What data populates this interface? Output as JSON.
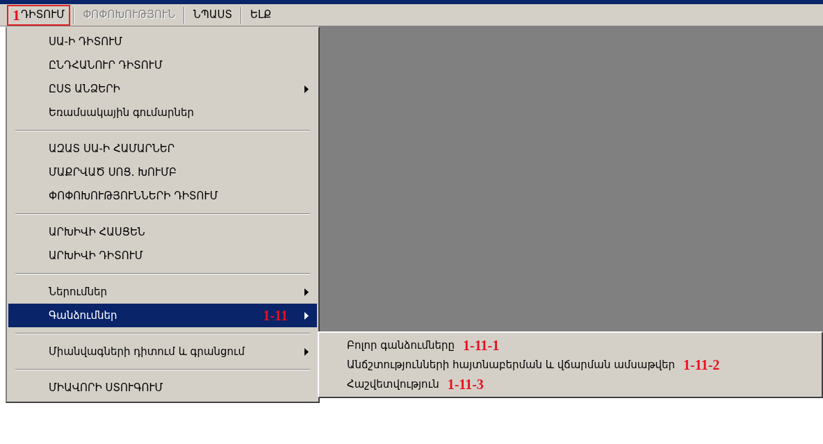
{
  "menubar": [
    {
      "label": "ԴԻՏՈՒՄ",
      "annotation": "1",
      "highlighted": true,
      "disabled": false
    },
    {
      "label": "ՓՈՓՈԽՈՒԹՅՈՒՆ",
      "highlighted": false,
      "disabled": true
    },
    {
      "label": "ՆՊԱՍՏ",
      "highlighted": false,
      "disabled": false
    },
    {
      "label": "ԵԼՔ",
      "highlighted": false,
      "disabled": false
    }
  ],
  "menu": {
    "items": [
      {
        "kind": "item",
        "label": "ՍԱ-Ի ԴԻՏՈՒՄ",
        "submenu": false,
        "selected": false
      },
      {
        "kind": "item",
        "label": "ԸՆԴՀԱՆՈՒՐ ԴԻՏՈՒՄ",
        "submenu": false,
        "selected": false
      },
      {
        "kind": "item",
        "label": "ԸՍՏ ԱՆՁԵՐԻ",
        "submenu": true,
        "selected": false
      },
      {
        "kind": "item",
        "label": "Եռամսակային գումարներ",
        "submenu": false,
        "selected": false
      },
      {
        "kind": "separator"
      },
      {
        "kind": "item",
        "label": "ԱԶԱՏ ՍԱ-Ի ՀԱՄԱՐՆԵՐ",
        "submenu": false,
        "selected": false
      },
      {
        "kind": "item",
        "label": "ՄԱՔՐՎԱԾ ՍՈՑ. ԽՈՒՄԲ",
        "submenu": false,
        "selected": false
      },
      {
        "kind": "item",
        "label": "ՓՈՓՈԽՈՒԹՅՈՒՆՆԵՐԻ ԴԻՏՈՒՄ",
        "submenu": false,
        "selected": false
      },
      {
        "kind": "separator"
      },
      {
        "kind": "item",
        "label": "ԱՐԽԻՎԻ ՀԱՍՑԵՆ",
        "submenu": false,
        "selected": false
      },
      {
        "kind": "item",
        "label": "ԱՐԽԻՎԻ ԴԻՏՈՒՄ",
        "submenu": false,
        "selected": false
      },
      {
        "kind": "separator"
      },
      {
        "kind": "item",
        "label": "Ներումներ",
        "submenu": true,
        "selected": false
      },
      {
        "kind": "item",
        "label": "Գանձումներ",
        "annotation": "1-11",
        "submenu": true,
        "selected": true
      },
      {
        "kind": "separator"
      },
      {
        "kind": "item",
        "label": "Միանվագների դիտում և գրանցում",
        "submenu": true,
        "selected": false
      },
      {
        "kind": "separator"
      },
      {
        "kind": "item",
        "label": "ՄԻԱՎՈՐԻ ՍՏՈՒԳՈՒՄ",
        "submenu": false,
        "selected": false
      }
    ]
  },
  "submenu": {
    "items": [
      {
        "label": "Բոլոր գանձումները",
        "annotation": "1-11-1"
      },
      {
        "label": "Անճշտությունների հայտնաբերման և վճարման ամսաթվեր",
        "annotation": "1-11-2"
      },
      {
        "label": "Հաշվետվություն",
        "annotation": "1-11-3"
      }
    ]
  }
}
